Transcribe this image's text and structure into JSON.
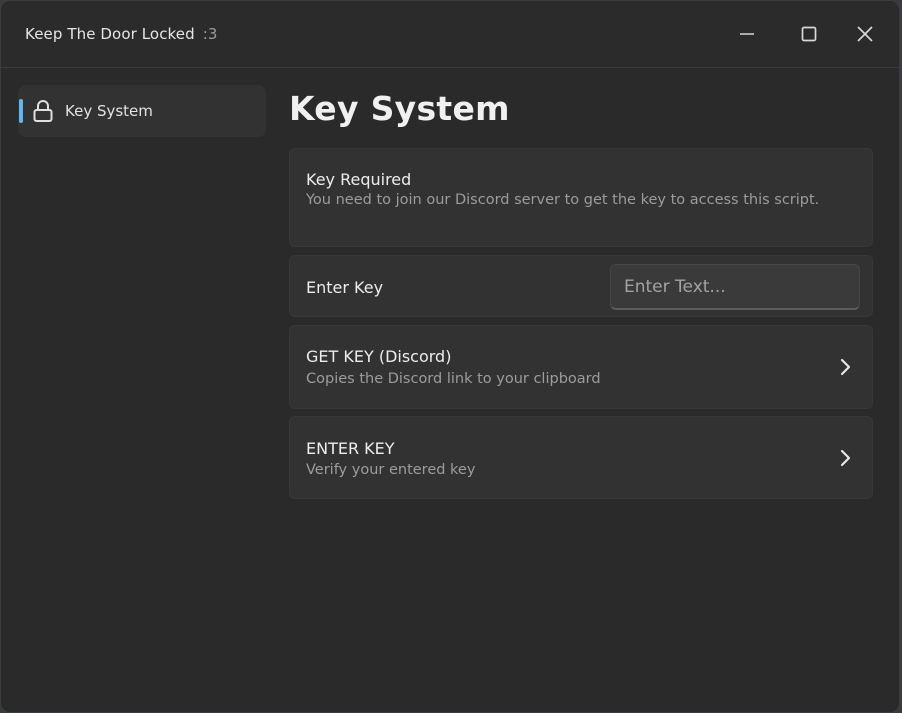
{
  "window": {
    "title": "Keep The Door Locked",
    "title_suffix": ":3",
    "controls": [
      "minimize-icon",
      "maximize-icon",
      "close-icon"
    ]
  },
  "sidebar": {
    "items": [
      {
        "label": "Key System",
        "icon": "lock-icon",
        "active": true
      }
    ]
  },
  "main": {
    "title": "Key System",
    "key_required": {
      "title": "Key Required",
      "description": "You need to join our Discord server to get the key to access this script."
    },
    "enter_key_input": {
      "label": "Enter Key",
      "value": "",
      "placeholder": "Enter Text..."
    },
    "get_key_button": {
      "title": "GET KEY (Discord)",
      "description": "Copies the Discord link to your clipboard"
    },
    "enter_key_button": {
      "title": "ENTER KEY",
      "description": "Verify your entered key"
    }
  },
  "colors": {
    "accent": "#5fb7ee",
    "background": "#2a2a2b",
    "card": "#323233"
  }
}
